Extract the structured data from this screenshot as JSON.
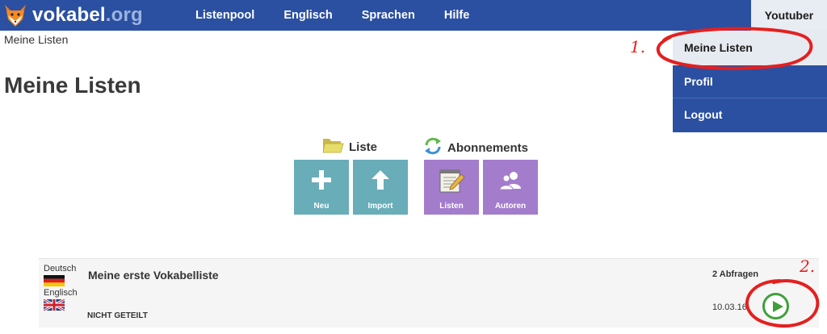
{
  "header": {
    "logo": {
      "text_main": "vokabel",
      "text_tld": ".org"
    },
    "nav": [
      "Listenpool",
      "Englisch",
      "Sprachen",
      "Hilfe"
    ],
    "user_label": "Youtuber"
  },
  "dropdown": {
    "items": [
      "Meine Listen",
      "Profil",
      "Logout"
    ],
    "active_index": 0
  },
  "breadcrumb": "Meine Listen",
  "page_title": "Meine Listen",
  "groups": {
    "liste": {
      "title": "Liste",
      "icon": "folder-icon",
      "tiles": [
        {
          "label": "Neu",
          "icon": "plus-icon"
        },
        {
          "label": "Import",
          "icon": "arrow-up-icon"
        }
      ]
    },
    "abonnements": {
      "title": "Abonnements",
      "icon": "refresh-icon",
      "tiles": [
        {
          "label": "Listen",
          "icon": "notepad-pencil-icon"
        },
        {
          "label": "Autoren",
          "icon": "users-icon"
        }
      ]
    }
  },
  "list_item": {
    "lang_from": "Deutsch",
    "lang_to": "Englisch",
    "title": "Meine erste Vokabelliste",
    "status": "NICHT GETEILT",
    "quiz_count": "2 Abfragen",
    "date": "10.03.16",
    "play_icon": "play-icon"
  },
  "annotations": {
    "step1": "1.",
    "step2": "2."
  },
  "colors": {
    "header_bg": "#2b50a1",
    "tile_teal": "#68adb8",
    "tile_purple": "#a37ccc",
    "play_green": "#3fa03b",
    "annotation_red": "#e4201f"
  }
}
